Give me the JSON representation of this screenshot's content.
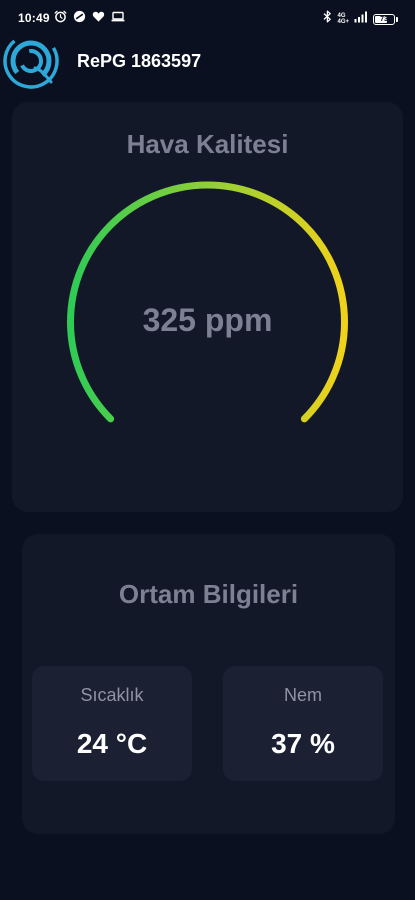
{
  "status_bar": {
    "time": "10:49",
    "network_type": "4G+",
    "network_sub": "4G",
    "battery": "73",
    "battery_level": 0.73,
    "icons": [
      "alarm-icon",
      "vpn-icon",
      "heart-icon",
      "laptop-icon",
      "bluetooth-icon",
      "signal-icon",
      "battery-icon"
    ]
  },
  "header": {
    "title": "RePG 1863597",
    "logo_icon": "swirl-logo-icon"
  },
  "air_quality": {
    "title": "Hava Kalitesi",
    "value_text": "325 ppm",
    "value": 325,
    "unit": "ppm",
    "gauge_colors": [
      "#2ecc55",
      "#f1d21a"
    ],
    "gauge_level": 1.0
  },
  "environment": {
    "title": "Ortam Bilgileri",
    "temperature": {
      "label": "Sıcaklık",
      "value_text": "24 °C"
    },
    "humidity": {
      "label": "Nem",
      "value_text": "37 %"
    }
  },
  "colors": {
    "background": "#0b1020",
    "card": "#121828",
    "stat_box": "#1b2133",
    "muted_text": "#7d8092",
    "logo": "#2ea8d8"
  }
}
